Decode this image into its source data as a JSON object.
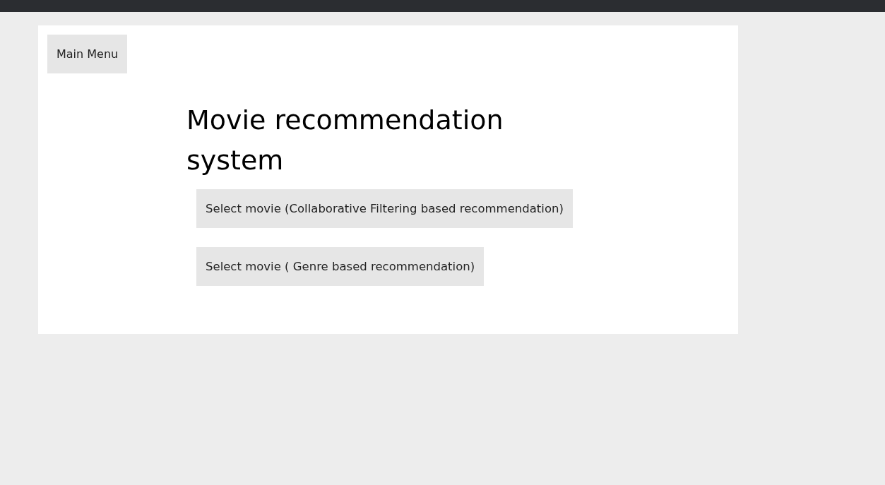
{
  "main_menu_button": "Main Menu",
  "title": "Movie recommendation system",
  "buttons": [
    "Select movie (Collaborative Filtering based recommendation)",
    "Select movie ( Genre based recommendation)"
  ]
}
